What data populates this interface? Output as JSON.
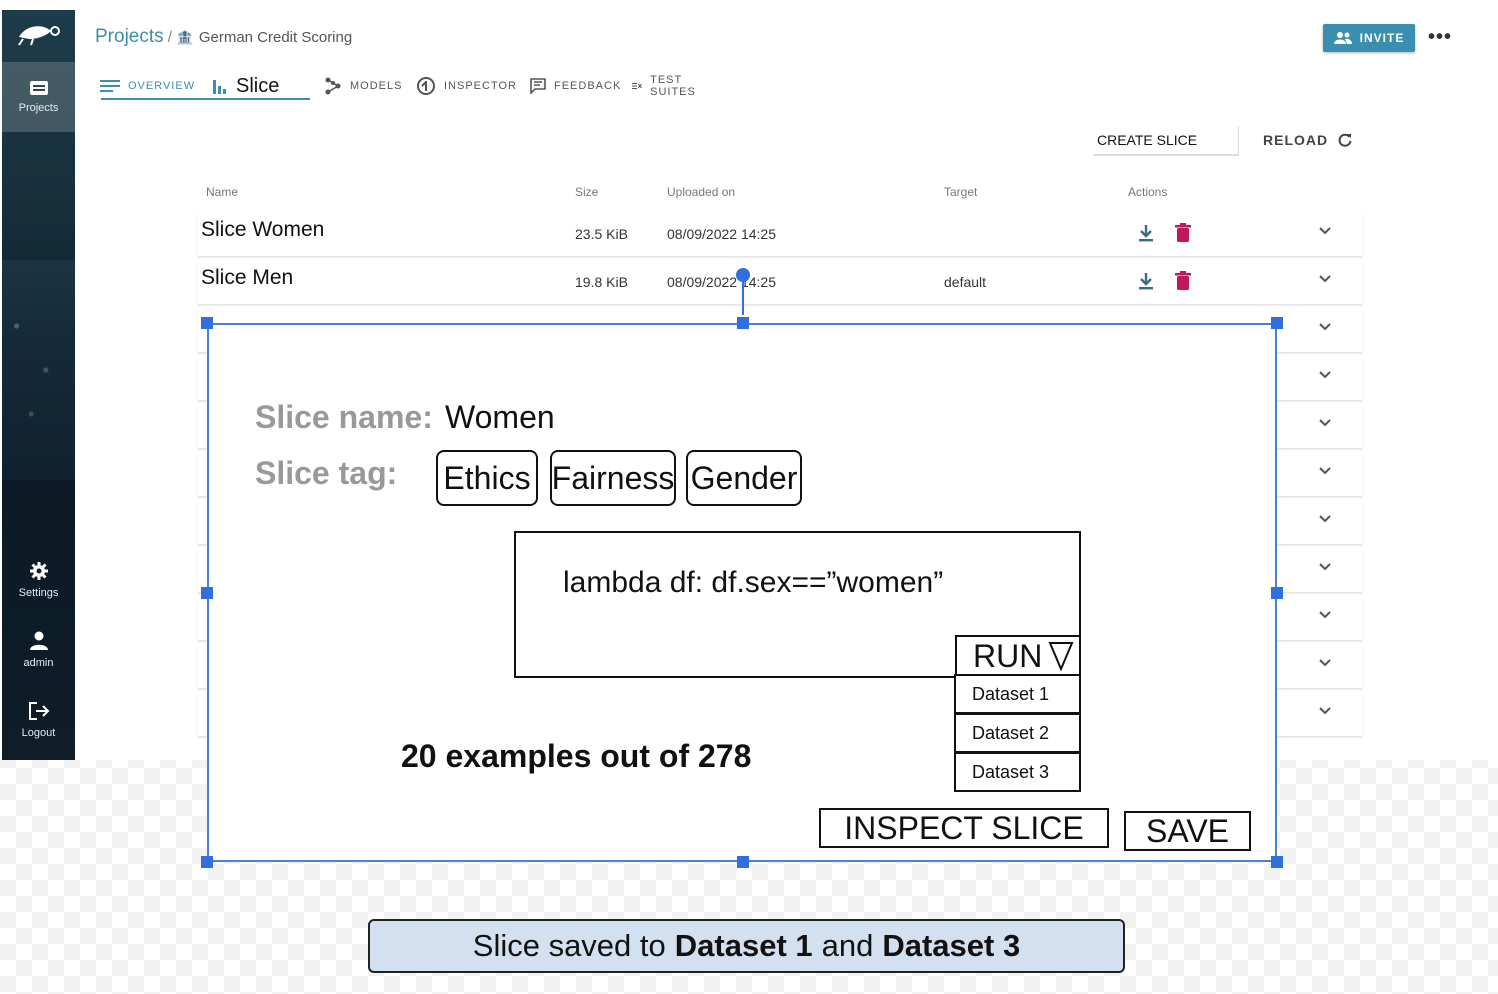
{
  "sidebar": {
    "items": [
      {
        "label": "Projects",
        "icon": "projects-icon"
      },
      {
        "label": "Settings",
        "icon": "gear-icon"
      },
      {
        "label": "admin",
        "icon": "user-icon"
      },
      {
        "label": "Logout",
        "icon": "logout-icon"
      }
    ]
  },
  "header": {
    "projects_link": "Projects",
    "separator": "/",
    "project_name": "German Credit Scoring",
    "invite_label": "INVITE",
    "more_label": "•••"
  },
  "tabs": [
    {
      "label": "OVERVIEW",
      "icon": "list-icon"
    },
    {
      "label": "Slice",
      "icon": "bar-chart-icon"
    },
    {
      "label": "MODELS",
      "icon": "models-icon"
    },
    {
      "label": "INSPECTOR",
      "icon": "inspector-icon"
    },
    {
      "label": "FEEDBACK",
      "icon": "feedback-icon"
    },
    {
      "label": "TEST SUITES",
      "icon": "test-suites-icon"
    }
  ],
  "toolbar": {
    "create_slice": "CREATE SLICE",
    "reload": "RELOAD"
  },
  "table": {
    "columns": [
      "Name",
      "Size",
      "Uploaded on",
      "Target",
      "Actions"
    ],
    "rows": [
      {
        "name": "Slice Women",
        "size": "23.5 KiB",
        "uploaded": "08/09/2022 14:25",
        "target": ""
      },
      {
        "name": "Slice Men",
        "size": "19.8 KiB",
        "uploaded": "08/09/2022 14:25",
        "target": "default"
      }
    ]
  },
  "dialog": {
    "name_label": "Slice name:",
    "name_value": "Women",
    "tag_label": "Slice tag:",
    "tags": [
      "Ethics",
      "Fairness",
      "Gender"
    ],
    "code": "lambda df: df.sex==”women”",
    "run_label": "RUN",
    "datasets": [
      "Dataset 1",
      "Dataset 2",
      "Dataset 3"
    ],
    "examples_text": "20 examples out of 278",
    "inspect_label": "INSPECT SLICE",
    "save_label": "SAVE"
  },
  "toast": {
    "prefix": "Slice saved to",
    "dataset_a": "Dataset 1",
    "joiner": "and",
    "dataset_b": "Dataset 3"
  },
  "colors": {
    "accent": "#3a8fae",
    "selection": "#2f6fe0",
    "delete": "#c2185b",
    "toast_bg": "#d3e0ef"
  }
}
